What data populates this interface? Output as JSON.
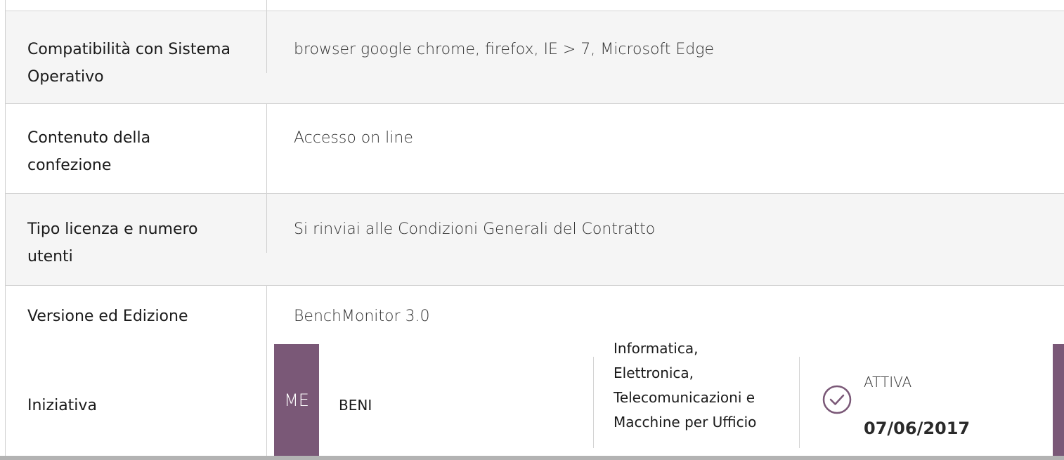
{
  "rows": [
    {
      "label": "Compatibilità con Sistema Operativo",
      "value": "browser google chrome, firefox, IE > 7, Microsoft Edge"
    },
    {
      "label": "Contenuto della confezione",
      "value": "Accesso on line"
    },
    {
      "label": "Tipo licenza e numero utenti",
      "value": "Si rinviai alle Condizioni Generali del Contratto"
    },
    {
      "label": "Versione ed Edizione",
      "value": "BenchMonitor 3.0"
    }
  ],
  "iniziativa": {
    "label": "Iniziativa",
    "badge": "ME",
    "tipo": "BENI",
    "categoria": "Informatica, Elettronica, Telecomunicazioni e Macchine per Ufficio",
    "status": "ATTIVA",
    "date": "07/06/2017",
    "accent_color": "#7a5877",
    "status_icon": "check-circle-icon"
  }
}
